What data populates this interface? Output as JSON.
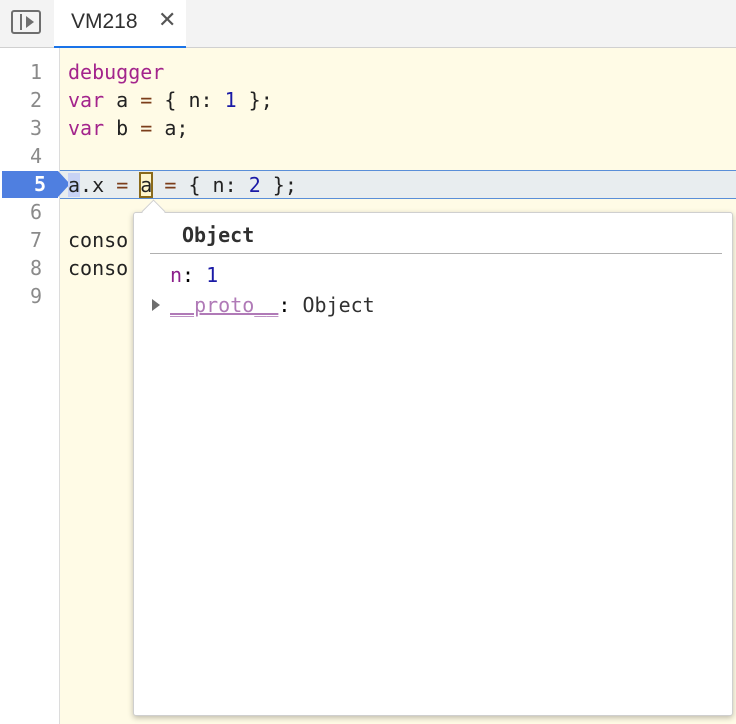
{
  "tab": {
    "label": "VM218",
    "close": "✕"
  },
  "gutter": {
    "lines": [
      "1",
      "2",
      "3",
      "4",
      "5",
      "6",
      "7",
      "8",
      "9"
    ],
    "current_line": "5"
  },
  "code": {
    "l1": {
      "kw": "debugger"
    },
    "l2": {
      "kw": "var",
      "name": "a",
      "eq": "=",
      "open": "{ n:",
      "num": "1",
      "close": "};"
    },
    "l3": {
      "kw": "var",
      "name": "b",
      "eq": "=",
      "rest": "a;"
    },
    "l5": {
      "a1": "a",
      "dot": ".",
      "x": "x",
      "eq1": "=",
      "a2": "a",
      "eq2": "=",
      "open": "{ n:",
      "num": "2",
      "close": "};"
    },
    "l7": "conso",
    "l8": "conso"
  },
  "popover": {
    "title": "Object",
    "props": [
      {
        "key": "n",
        "sep": ": ",
        "value": "1"
      },
      {
        "key": "__proto__",
        "sep": ": ",
        "value": "Object"
      }
    ]
  },
  "colors": {
    "keyword": "#a3248c",
    "number": "#1a1aa6",
    "breakpoint": "#4f7fe0",
    "code_bg": "#fffbe6"
  }
}
